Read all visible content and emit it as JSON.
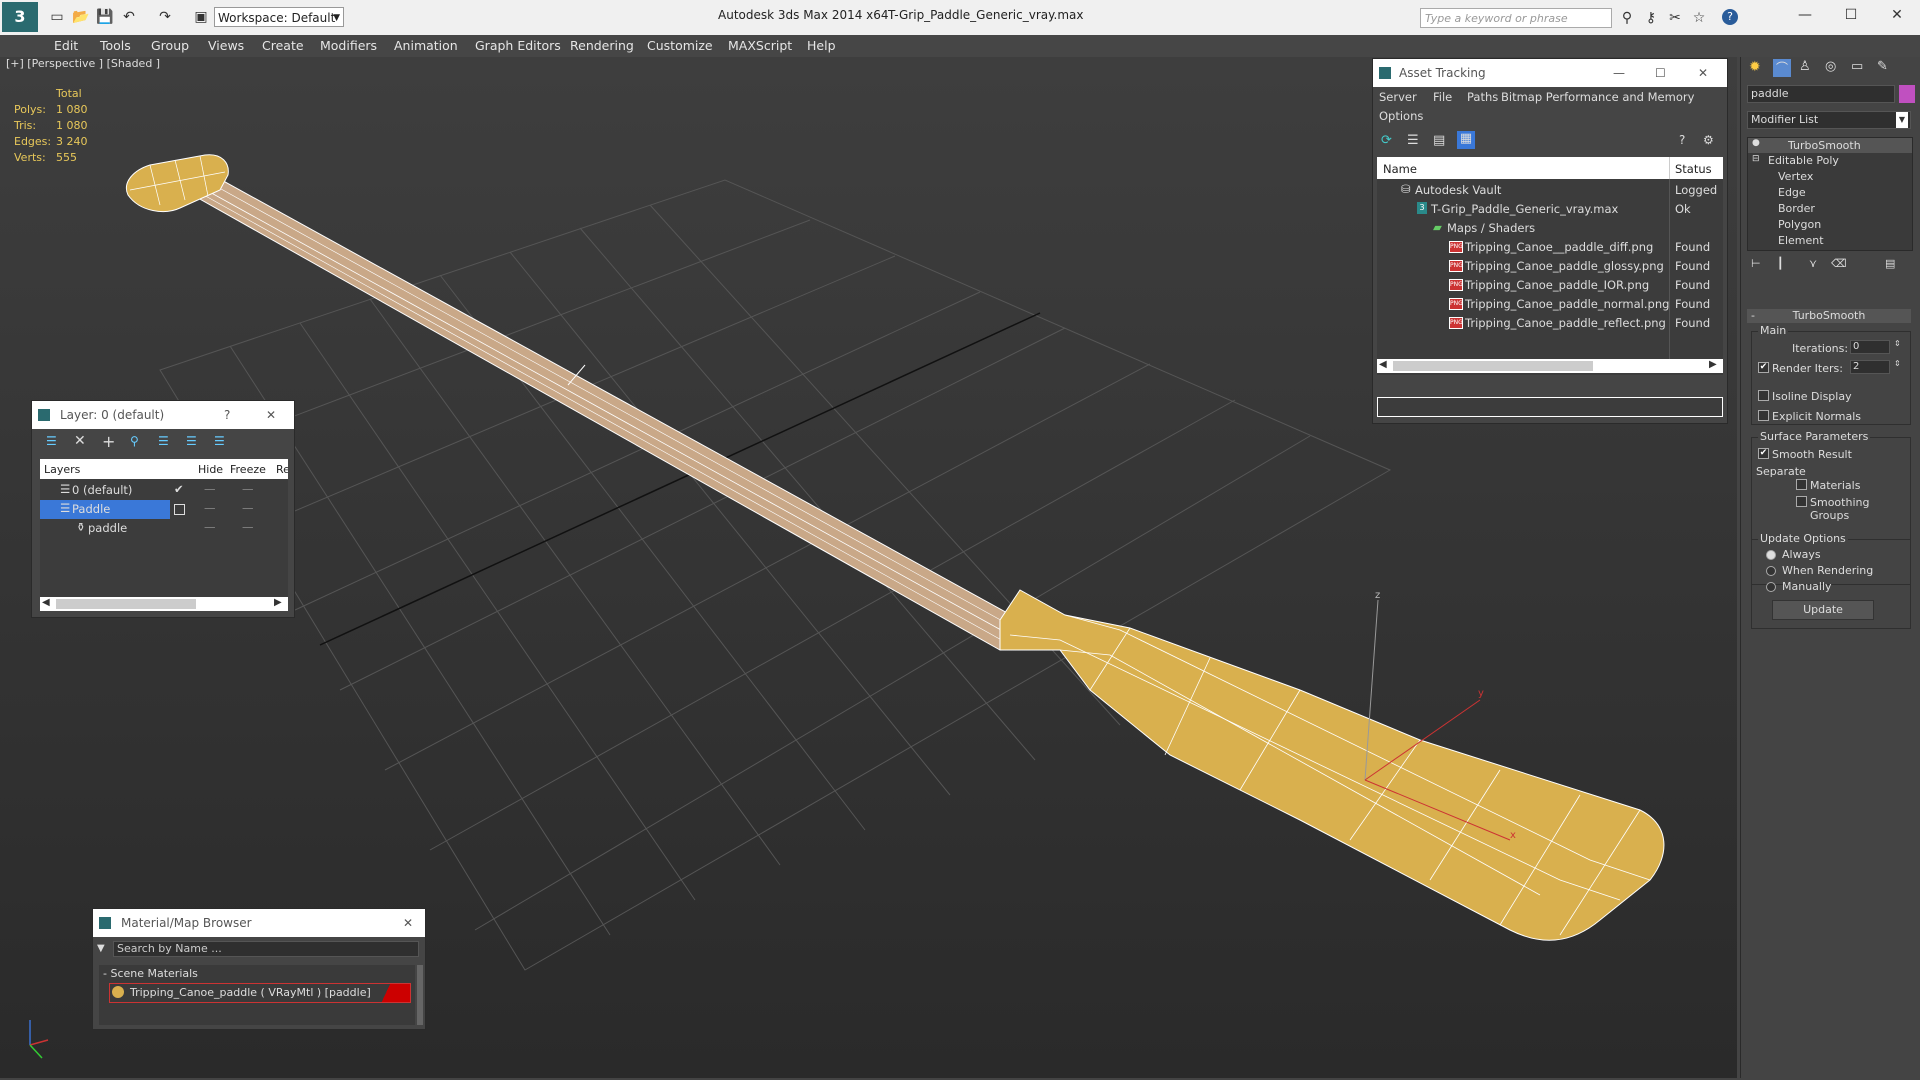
{
  "title_bar": {
    "workspace": "Workspace: Default",
    "app_title": "Autodesk 3ds Max  2014 x64",
    "file_title": "T-Grip_Paddle_Generic_vray.max",
    "search_placeholder": "Type a keyword or phrase"
  },
  "menu": [
    "Edit",
    "Tools",
    "Group",
    "Views",
    "Create",
    "Modifiers",
    "Animation",
    "Graph Editors",
    "Rendering",
    "Customize",
    "MAXScript",
    "Help"
  ],
  "viewport": {
    "label": "[+] [Perspective ] [Shaded ]",
    "stats": {
      "header": "Total",
      "rows": [
        {
          "k": "Polys:",
          "v": "1 080"
        },
        {
          "k": "Tris:",
          "v": "1 080"
        },
        {
          "k": "Edges:",
          "v": "3 240"
        },
        {
          "k": "Verts:",
          "v": "555"
        }
      ]
    },
    "gizmo": {
      "x": "x",
      "y": "y",
      "z": "z"
    }
  },
  "asset_tracking": {
    "title": "Asset Tracking",
    "menu": [
      "Server",
      "File",
      "Paths",
      "Bitmap Performance and Memory",
      "Options"
    ],
    "columns": [
      "Name",
      "Status"
    ],
    "rows": [
      {
        "name": "Autodesk Vault",
        "status": "Logged O",
        "indent": 1,
        "icon": "vault"
      },
      {
        "name": "T-Grip_Paddle_Generic_vray.max",
        "status": "Ok",
        "indent": 2,
        "icon": "max"
      },
      {
        "name": "Maps / Shaders",
        "status": "",
        "indent": 3,
        "icon": "folder"
      },
      {
        "name": "Tripping_Canoe__paddle_diff.png",
        "status": "Found",
        "indent": 4,
        "icon": "png"
      },
      {
        "name": "Tripping_Canoe_paddle_glossy.png",
        "status": "Found",
        "indent": 4,
        "icon": "png"
      },
      {
        "name": "Tripping_Canoe_paddle_IOR.png",
        "status": "Found",
        "indent": 4,
        "icon": "png"
      },
      {
        "name": "Tripping_Canoe_paddle_normal.png",
        "status": "Found",
        "indent": 4,
        "icon": "png"
      },
      {
        "name": "Tripping_Canoe_paddle_reflect.png",
        "status": "Found",
        "indent": 4,
        "icon": "png"
      }
    ]
  },
  "layer_window": {
    "title": "Layer: 0 (default)",
    "help": "?",
    "columns": [
      "Layers",
      "Hide",
      "Freeze",
      "Re"
    ],
    "rows": [
      {
        "name": "0 (default)",
        "checked": true
      },
      {
        "name": "Paddle",
        "selected": true
      },
      {
        "name": "paddle",
        "child": true
      }
    ]
  },
  "material_browser": {
    "title": "Material/Map Browser",
    "search_placeholder": "Search by Name ...",
    "group": "- Scene Materials",
    "item": "Tripping_Canoe_paddle ( VRayMtl ) [paddle]"
  },
  "command_panel": {
    "object_name": "paddle",
    "modifier_list": "Modifier List",
    "stack": [
      "TurboSmooth",
      "Editable Poly",
      "Vertex",
      "Edge",
      "Border",
      "Polygon",
      "Element"
    ],
    "turbosmooth": {
      "title": "TurboSmooth",
      "main": "Main",
      "iterations_label": "Iterations:",
      "iterations": "0",
      "render_iters_label": "Render Iters:",
      "render_iters": "2",
      "isoline": "Isoline Display",
      "explicit": "Explicit Normals",
      "surface": "Surface Parameters",
      "smooth_result": "Smooth Result",
      "separate": "Separate",
      "materials": "Materials",
      "smoothing_groups": "Smoothing Groups",
      "update_options": "Update Options",
      "always": "Always",
      "when_rendering": "When Rendering",
      "manually": "Manually",
      "update_button": "Update"
    },
    "colors": {
      "object_swatch": "#c050c0"
    }
  },
  "colors": {
    "paddle_fill": "#d9b04e",
    "shaft": "#c9a888",
    "selection": "#3a78d8"
  }
}
